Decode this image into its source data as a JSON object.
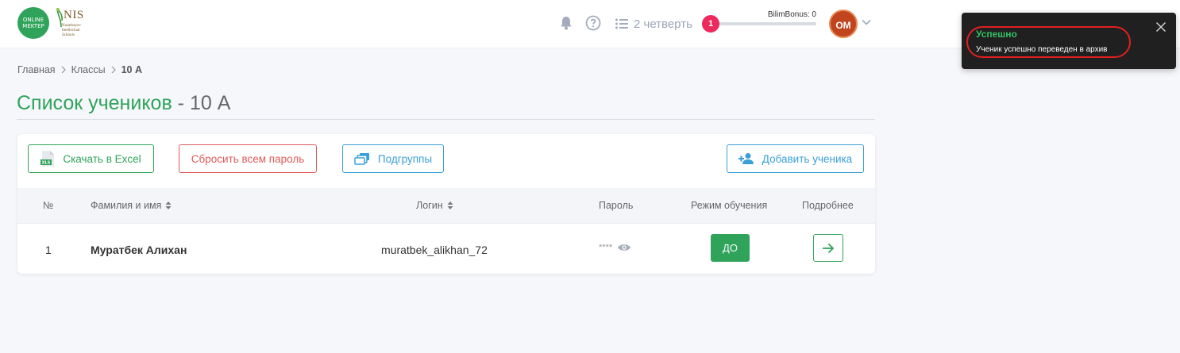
{
  "header": {
    "logo_online_mektep": "ONLINE MEKTEP",
    "logo_nis": "NIS",
    "logo_nis_sub": "Nazarbayev Intellectual Schools",
    "quarter_label": "2 четверть",
    "bonus_count": "1",
    "bonus_label": "BilimBonus: 0",
    "bonus_progress": 0,
    "avatar_initials": "OM"
  },
  "toast": {
    "title": "Успешно",
    "message": "Ученик успешно переведен в архив"
  },
  "breadcrumb": {
    "items": [
      "Главная",
      "Классы"
    ],
    "current": "10 А"
  },
  "page": {
    "title_main": "Список учеников",
    "title_sub": " - 10 А"
  },
  "toolbar": {
    "excel_label": "Скачать в Excel",
    "excel_icon_text": "XLS",
    "reset_label": "Сбросить всем пароль",
    "subgroups_label": "Подгруппы",
    "add_label": "Добавить ученика"
  },
  "table": {
    "headers": {
      "num": "№",
      "name": "Фамилия и имя",
      "login": "Логин",
      "password": "Пароль",
      "mode": "Режим обучения",
      "details": "Подробнее"
    },
    "rows": [
      {
        "num": "1",
        "name": "Муратбек Алихан",
        "login": "muratbek_alikhan_72",
        "password": "****",
        "mode": "ДО"
      }
    ]
  },
  "colors": {
    "brand_green": "#2fa35a",
    "danger_red": "#e05a5a",
    "info_blue": "#3a9fd8",
    "badge_pink": "#ec2a5b",
    "toast_bg": "#202020"
  }
}
